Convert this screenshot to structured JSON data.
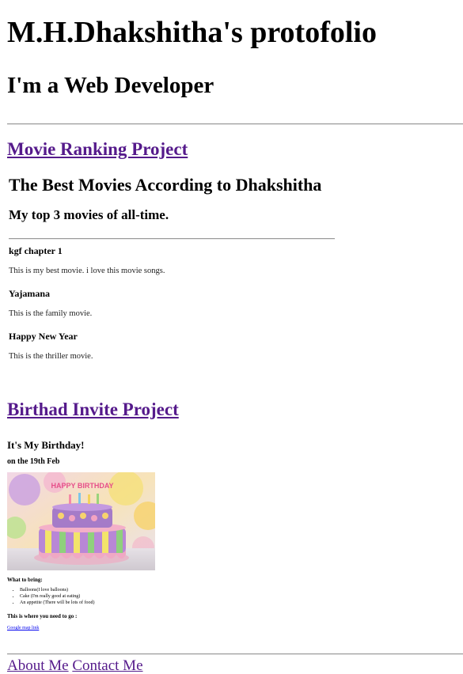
{
  "header": {
    "title": "M.H.Dhakshitha's protofolio",
    "subtitle": "I'm a Web Developer"
  },
  "movie_project": {
    "link_label": "Movie Ranking Project",
    "title": "The Best Movies According to Dhakshitha",
    "subtitle": "My top 3 movies of all-time.",
    "movies": [
      {
        "name": "kgf chapter 1",
        "description": "This is my best movie. i love this movie songs."
      },
      {
        "name": "Yajamana",
        "description": "This is the family movie."
      },
      {
        "name": "Happy New Year",
        "description": "This is the thriller movie."
      }
    ]
  },
  "birthday_project": {
    "link_label": "Birthad Invite Project",
    "heading": "It's My Birthday!",
    "date": "on the 19th Feb",
    "cake_topper_text": "HAPPY BIRTHDAY",
    "bring_title": "What to bring:",
    "bring_items": [
      "Balloons(I love balloons)",
      "Cake (I'm really good at eating)",
      "An appetite (There will be lots of food)"
    ],
    "where_label": "This is where you need to go :",
    "map_link": "Google map link"
  },
  "footer": {
    "about_label": "About Me",
    "contact_label": "Contact Me"
  }
}
